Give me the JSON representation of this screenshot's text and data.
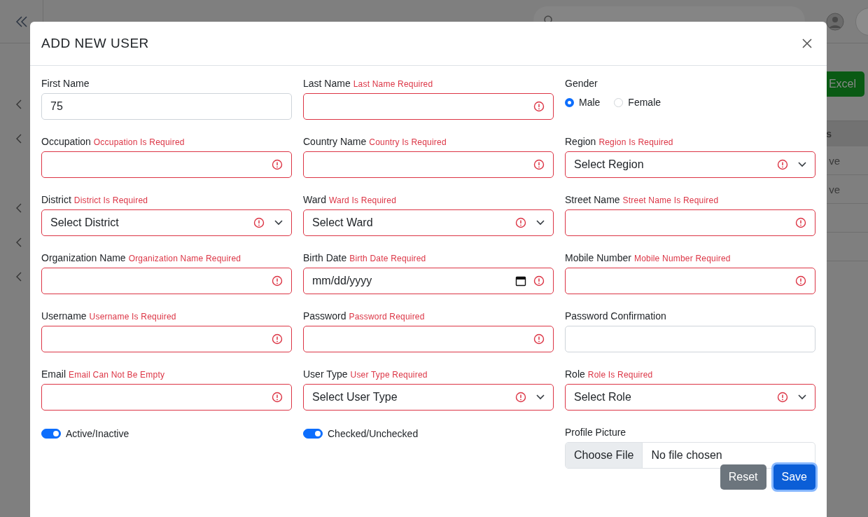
{
  "page": {
    "excel_button": "Excel",
    "table": {
      "header": "s",
      "cells": [
        "ve",
        "ve"
      ]
    }
  },
  "modal": {
    "title": "ADD NEW USER",
    "fields": [
      {
        "kind": "text",
        "label": "First Name",
        "value": "75",
        "invalid": false
      },
      {
        "kind": "text",
        "label": "Last Name",
        "error": "Last Name Required",
        "invalid": true
      },
      {
        "kind": "radio",
        "label": "Gender",
        "options": [
          {
            "label": "Male",
            "selected": true
          },
          {
            "label": "Female",
            "selected": false
          }
        ]
      },
      {
        "kind": "text",
        "label": "Occupation",
        "error": "Occupation Is Required",
        "invalid": true
      },
      {
        "kind": "text",
        "label": "Country Name",
        "error": "Country Is Required",
        "invalid": true
      },
      {
        "kind": "select",
        "label": "Region",
        "error": "Region Is Required",
        "value": "Select Region",
        "invalid": true
      },
      {
        "kind": "select",
        "label": "District",
        "error": "District Is Required",
        "value": "Select District",
        "invalid": true
      },
      {
        "kind": "select",
        "label": "Ward",
        "error": "Ward Is Required",
        "value": "Select Ward",
        "invalid": true
      },
      {
        "kind": "text",
        "label": "Street Name",
        "error": "Street Name Is Required",
        "invalid": true
      },
      {
        "kind": "text",
        "label": "Organization Name",
        "error": "Organization Name Required",
        "invalid": true
      },
      {
        "kind": "date",
        "label": "Birth Date",
        "error": "Birth Date Required",
        "placeholder": "mm/dd/yyyy",
        "invalid": true
      },
      {
        "kind": "text",
        "label": "Mobile Number",
        "error": "Mobile Number Required",
        "invalid": true
      },
      {
        "kind": "text",
        "label": "Username",
        "error": "Username Is Required",
        "invalid": true
      },
      {
        "kind": "text",
        "label": "Password",
        "error": "Password Required",
        "invalid": true
      },
      {
        "kind": "text",
        "label": "Password Confirmation",
        "invalid": false
      },
      {
        "kind": "text",
        "label": "Email",
        "error": "Email Can Not Be Empty",
        "invalid": true
      },
      {
        "kind": "select",
        "label": "User Type",
        "error": "User Type Required",
        "value": "Select User Type",
        "invalid": true
      },
      {
        "kind": "select",
        "label": "Role",
        "error": "Role Is Required",
        "value": "Select Role",
        "invalid": true
      },
      {
        "kind": "switch",
        "label": "Active/Inactive",
        "on": true
      },
      {
        "kind": "switch",
        "label": "Checked/Unchecked",
        "on": true
      },
      {
        "kind": "file",
        "label": "Profile Picture",
        "button": "Choose File",
        "status": "No file chosen"
      }
    ],
    "buttons": [
      {
        "kind": "secondary",
        "label": "Reset"
      },
      {
        "kind": "primary",
        "label": "Save",
        "focused": true
      }
    ]
  }
}
